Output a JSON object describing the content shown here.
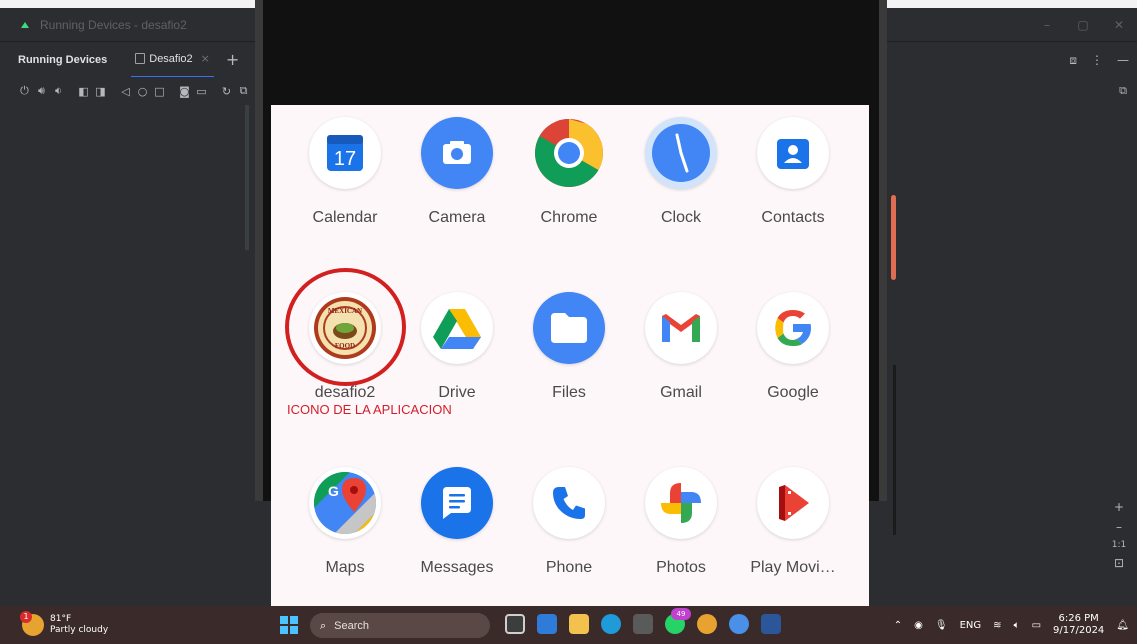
{
  "window": {
    "title": "Running Devices - desafio2",
    "controls": [
      "–",
      "▢",
      "✕"
    ]
  },
  "tabs": {
    "panel_name": "Running Devices",
    "active_tab": "Desafio2",
    "close_glyph": "×",
    "add_glyph": "+"
  },
  "toolbar": {
    "icons": [
      "power-icon",
      "volume-up-icon",
      "volume-down-icon",
      "rotate-left-icon",
      "rotate-right-icon",
      "back-icon",
      "home-icon",
      "overview-icon",
      "screenshot-icon",
      "screen-record-icon",
      "snapshot-icon",
      "more-icon"
    ]
  },
  "apps_row1": [
    {
      "label": "Calendar",
      "icon": "calendar-icon",
      "day": "17"
    },
    {
      "label": "Camera",
      "icon": "camera-icon"
    },
    {
      "label": "Chrome",
      "icon": "chrome-icon"
    },
    {
      "label": "Clock",
      "icon": "clock-icon"
    },
    {
      "label": "Contacts",
      "icon": "contacts-icon"
    }
  ],
  "apps_row2": [
    {
      "label": "desafio2",
      "icon": "mexican-food-logo-icon",
      "logo_text": [
        "MEXICAN",
        "FOOD"
      ]
    },
    {
      "label": "Drive",
      "icon": "drive-icon"
    },
    {
      "label": "Files",
      "icon": "files-icon"
    },
    {
      "label": "Gmail",
      "icon": "gmail-icon"
    },
    {
      "label": "Google",
      "icon": "google-icon"
    }
  ],
  "apps_row3": [
    {
      "label": "Maps",
      "icon": "maps-icon"
    },
    {
      "label": "Messages",
      "icon": "messages-icon"
    },
    {
      "label": "Phone",
      "icon": "phone-icon"
    },
    {
      "label": "Photos",
      "icon": "photos-icon"
    },
    {
      "label": "Play Movi…",
      "icon": "play-movies-icon"
    }
  ],
  "annotation": {
    "text": "ICONO DE LA APLICACION",
    "color": "#d01f2b"
  },
  "zoom": {
    "plus": "+",
    "minus": "–",
    "ratio": "1:1"
  },
  "taskbar": {
    "temperature": "81°F",
    "condition": "Partly cloudy",
    "weather_badge": "1",
    "search_placeholder": "Search",
    "language": "ENG",
    "time": "6:26 PM",
    "date": "9/17/2024",
    "chat_badge": "49"
  },
  "colors": {
    "ide_bg": "#2b2d30",
    "screen_bg": "#fdf7f9",
    "accent_tab": "#3574f0",
    "scroll_handle": "#e06c54",
    "taskbar_bg": "#3a2b2a"
  }
}
